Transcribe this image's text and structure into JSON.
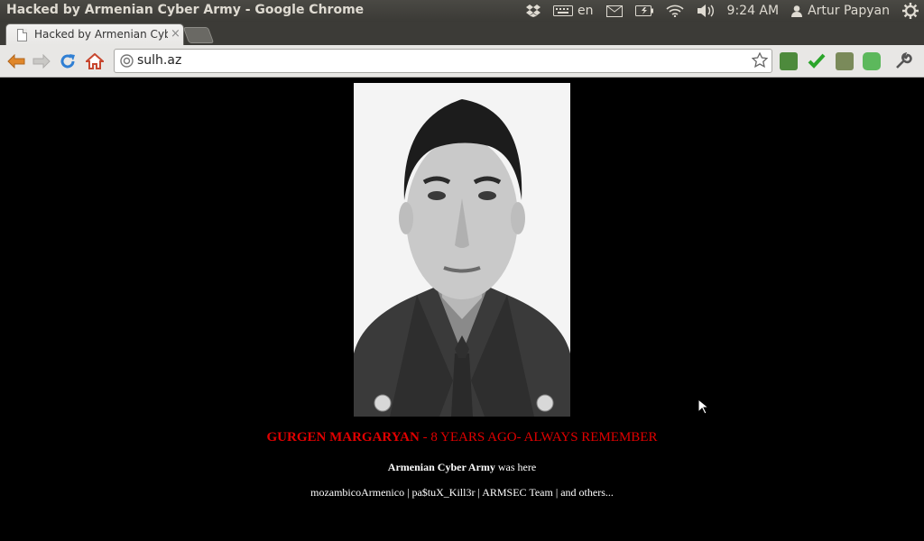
{
  "window": {
    "title": "Hacked by Armenian Cyber Army - Google Chrome"
  },
  "panel": {
    "keyboard_layout": "en",
    "time": "9:24 AM",
    "user": "Artur Papyan"
  },
  "tabs": [
    {
      "label": "Hacked by Armenian Cyber Army",
      "active": true
    }
  ],
  "omnibox": {
    "url": "sulh.az"
  },
  "page": {
    "headline_name": "GURGEN MARGARYAN",
    "headline_rest": " - 8 YEARS AGO- ALWAYS REMEMBER",
    "line2_bold": "Armenian Cyber Army",
    "line2_rest": " was here",
    "line3": "mozambicoArmenico | pa$tuX_Kill3r | ARMSEC Team | and others..."
  },
  "colors": {
    "headline": "#e00000",
    "page_bg": "#000000",
    "panel_bg": "#3c3b37"
  }
}
